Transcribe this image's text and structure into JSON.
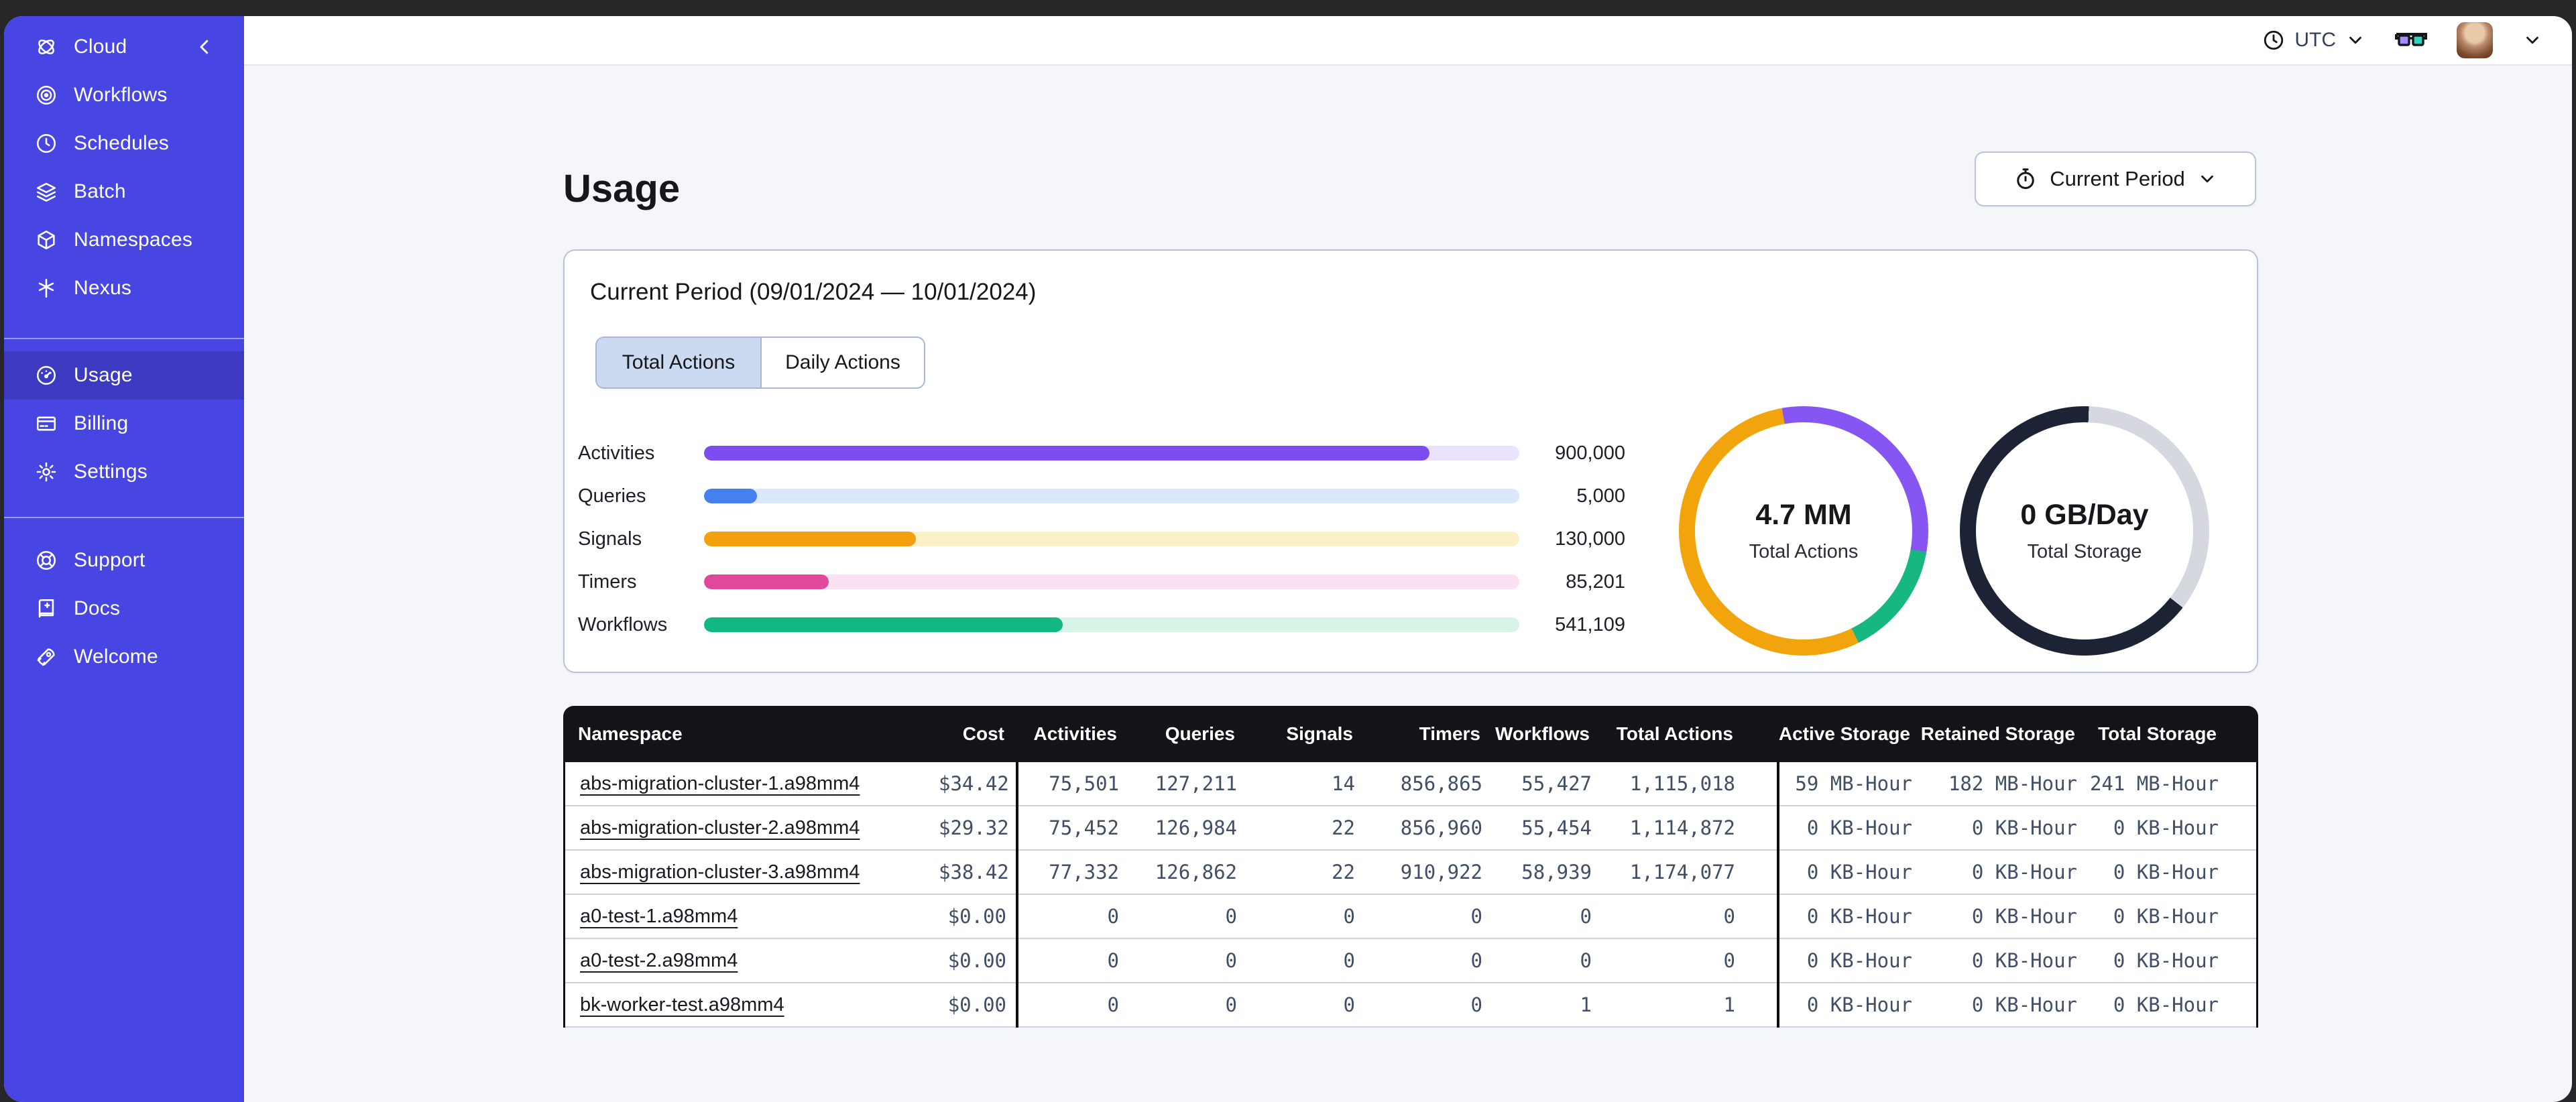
{
  "topbar": {
    "timezone": "UTC",
    "icons": [
      "clock-icon",
      "timezone-chevron",
      "glasses-icon",
      "avatar",
      "account-chevron"
    ]
  },
  "sidebar": {
    "brand": "Cloud",
    "items": [
      {
        "label": "Workflows",
        "icon": "workflows-icon",
        "selected": false
      },
      {
        "label": "Schedules",
        "icon": "schedules-icon",
        "selected": false
      },
      {
        "label": "Batch",
        "icon": "batch-icon",
        "selected": false
      },
      {
        "label": "Namespaces",
        "icon": "namespaces-icon",
        "selected": false
      },
      {
        "label": "Nexus",
        "icon": "nexus-icon",
        "selected": false
      },
      {
        "label": "Usage",
        "icon": "usage-icon",
        "selected": true
      },
      {
        "label": "Billing",
        "icon": "billing-icon",
        "selected": false
      },
      {
        "label": "Settings",
        "icon": "settings-icon",
        "selected": false
      },
      {
        "label": "Support",
        "icon": "support-icon",
        "selected": false
      },
      {
        "label": "Docs",
        "icon": "docs-icon",
        "selected": false
      },
      {
        "label": "Welcome",
        "icon": "welcome-icon",
        "selected": false
      }
    ]
  },
  "page": {
    "title": "Usage"
  },
  "period_button": {
    "label": "Current Period",
    "icon": "stopwatch-icon"
  },
  "usage_card": {
    "title": "Current Period (09/01/2024 — 10/01/2024)",
    "tabs": [
      {
        "label": "Total Actions",
        "selected": true
      },
      {
        "label": "Daily Actions",
        "selected": false
      }
    ],
    "chart_data": {
      "type": "bar",
      "categories": [
        "Activities",
        "Queries",
        "Signals",
        "Timers",
        "Workflows"
      ],
      "values": [
        900000,
        5000,
        130000,
        85201,
        541109
      ],
      "value_labels": [
        "900,000",
        "5,000",
        "130,000",
        "85,201",
        "541,109"
      ],
      "bars": [
        {
          "label": "Activities",
          "value_label": "900,000",
          "fill_pct": 89,
          "color": "#7c4cef",
          "track_color": "#eae3fb"
        },
        {
          "label": "Queries",
          "value_label": "5,000",
          "fill_pct": 6.5,
          "color": "#4580ef",
          "track_color": "#dbe7fa"
        },
        {
          "label": "Signals",
          "value_label": "130,000",
          "fill_pct": 26,
          "color": "#f2a00d",
          "track_color": "#fbf0c8"
        },
        {
          "label": "Timers",
          "value_label": "85,201",
          "fill_pct": 15.3,
          "color": "#e0489c",
          "track_color": "#fae2f3"
        },
        {
          "label": "Workflows",
          "value_label": "541,109",
          "fill_pct": 44,
          "color": "#12b783",
          "track_color": "#d7f5e7"
        }
      ],
      "donuts": [
        {
          "center_value": "4.7 MM",
          "center_label": "Total Actions",
          "start_deg": -10,
          "segments": [
            {
              "name": "activities",
              "color": "#8655f2",
              "from": 0,
              "to": 30.5
            },
            {
              "name": "workflows",
              "color": "#16b87f",
              "from": 30.5,
              "to": 45.5
            },
            {
              "name": "signals-timers",
              "color": "#f2a40c",
              "from": 45.5,
              "to": 100
            }
          ]
        },
        {
          "center_value": "0 GB/Day",
          "center_label": "Total Storage",
          "start_deg": 2,
          "segments": [
            {
              "name": "retained",
              "color": "#d5d8de",
              "from": 0,
              "to": 35
            },
            {
              "name": "active",
              "color": "#1b2334",
              "from": 35,
              "to": 100
            }
          ]
        }
      ]
    }
  },
  "table": {
    "columns": [
      "Namespace",
      "Cost",
      "Activities",
      "Queries",
      "Signals",
      "Timers",
      "Workflows",
      "Total Actions",
      "Active Storage",
      "Retained Storage",
      "Total Storage"
    ],
    "rows": [
      [
        "abs-migration-cluster-1.a98mm4",
        "$34.42",
        "75,501",
        "127,211",
        "14",
        "856,865",
        "55,427",
        "1,115,018",
        "59 MB-Hour",
        "182 MB-Hour",
        "241 MB-Hour"
      ],
      [
        "abs-migration-cluster-2.a98mm4",
        "$29.32",
        "75,452",
        "126,984",
        "22",
        "856,960",
        "55,454",
        "1,114,872",
        "0 KB-Hour",
        "0 KB-Hour",
        "0 KB-Hour"
      ],
      [
        "abs-migration-cluster-3.a98mm4",
        "$38.42",
        "77,332",
        "126,862",
        "22",
        "910,922",
        "58,939",
        "1,174,077",
        "0 KB-Hour",
        "0 KB-Hour",
        "0 KB-Hour"
      ],
      [
        "a0-test-1.a98mm4",
        "$0.00",
        "0",
        "0",
        "0",
        "0",
        "0",
        "0",
        "0 KB-Hour",
        "0 KB-Hour",
        "0 KB-Hour"
      ],
      [
        "a0-test-2.a98mm4",
        "$0.00",
        "0",
        "0",
        "0",
        "0",
        "0",
        "0",
        "0 KB-Hour",
        "0 KB-Hour",
        "0 KB-Hour"
      ],
      [
        "bk-worker-test.a98mm4",
        "$0.00",
        "0",
        "0",
        "0",
        "0",
        "1",
        "1",
        "0 KB-Hour",
        "0 KB-Hour",
        "0 KB-Hour"
      ]
    ]
  }
}
